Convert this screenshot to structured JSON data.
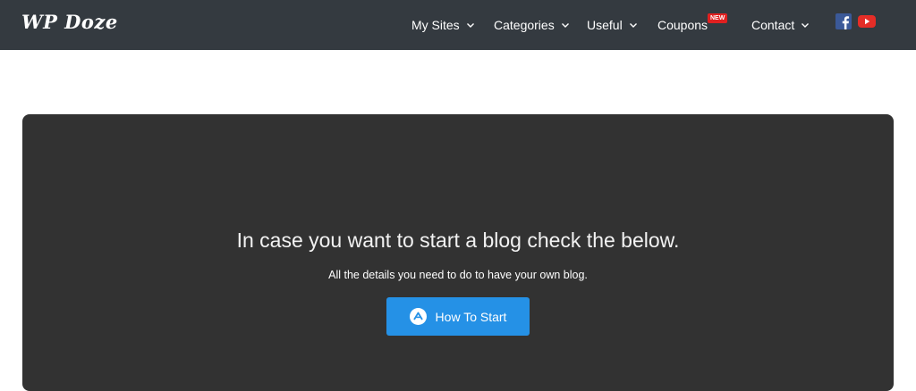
{
  "header": {
    "logo": "WP Doze",
    "nav": [
      {
        "label": "My Sites"
      },
      {
        "label": "Categories"
      },
      {
        "label": "Useful"
      },
      {
        "label": "Coupons",
        "badge": "NEW"
      },
      {
        "label": "Contact"
      }
    ],
    "social": [
      "facebook-icon",
      "youtube-icon"
    ]
  },
  "hero": {
    "title": "In case you want to start a blog check the below.",
    "subtitle": "All the details you need to do to have your own blog.",
    "button_label": "How To Start"
  },
  "colors": {
    "navbar": "#343a40",
    "hero_bg": "#323232",
    "button": "#2591e6",
    "badge": "#e02020",
    "facebook": "#3b5998",
    "youtube": "#e52d27"
  }
}
